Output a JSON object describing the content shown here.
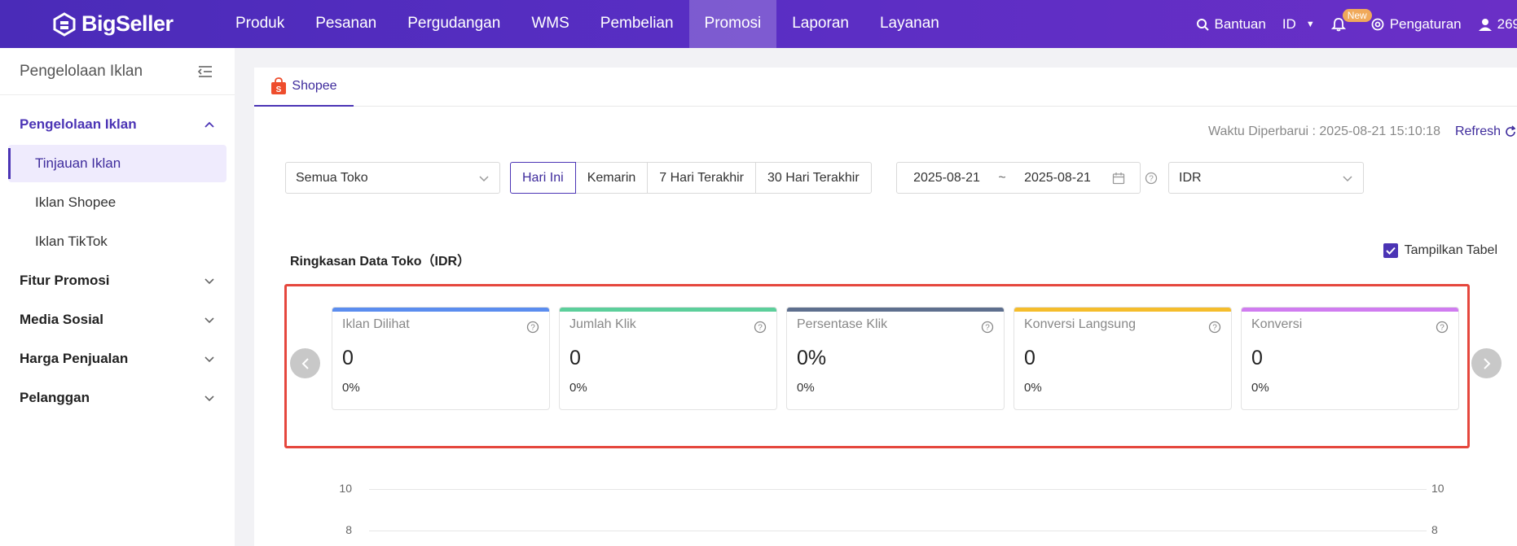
{
  "brand": {
    "name": "BigSeller"
  },
  "topnav": {
    "items": [
      "Produk",
      "Pesanan",
      "Pergudangan",
      "WMS",
      "Pembelian",
      "Promosi",
      "Laporan",
      "Layanan"
    ],
    "active": "Promosi",
    "help_label": "Bantuan",
    "language": "ID",
    "new_badge": "New",
    "settings_label": "Pengaturan",
    "user_label": "269"
  },
  "sidebar": {
    "title": "Pengelolaan Iklan",
    "groups": [
      {
        "label": "Pengelolaan Iklan",
        "open": true,
        "items": [
          {
            "label": "Tinjauan Iklan",
            "active": true
          },
          {
            "label": "Iklan Shopee"
          },
          {
            "label": "Iklan TikTok"
          }
        ]
      },
      {
        "label": "Fitur Promosi"
      },
      {
        "label": "Media Sosial"
      },
      {
        "label": "Harga Penjualan"
      },
      {
        "label": "Pelanggan"
      }
    ]
  },
  "main": {
    "tab": "Shopee",
    "update_text": "Waktu Diperbarui : 2025-08-21 15:10:18",
    "refresh_label": "Refresh",
    "shop_select": "Semua Toko",
    "range_buttons": [
      "Hari Ini",
      "Kemarin",
      "7 Hari Terakhir",
      "30 Hari Terakhir"
    ],
    "range_active": "Hari Ini",
    "date_from": "2025-08-21",
    "date_sep": "~",
    "date_to": "2025-08-21",
    "currency": "IDR",
    "section_title": "Ringkasan Data Toko（IDR）",
    "show_table_label": "Tampilkan Tabel",
    "show_table_checked": true,
    "cards": [
      {
        "label": "Iklan Dilihat",
        "value": "0",
        "pct": "0%",
        "color": "#5b8def"
      },
      {
        "label": "Jumlah Klik",
        "value": "0",
        "pct": "0%",
        "color": "#5ccf9b"
      },
      {
        "label": "Persentase Klik",
        "value": "0%",
        "pct": "0%",
        "color": "#5e6f8e"
      },
      {
        "label": "Konversi Langsung",
        "value": "0",
        "pct": "0%",
        "color": "#f5bd2c"
      },
      {
        "label": "Konversi",
        "value": "0",
        "pct": "0%",
        "color": "#d07cf0"
      }
    ],
    "axis_ticks": [
      "10",
      "8"
    ]
  },
  "colors": {
    "nav": "#5a2ec4",
    "accent": "#4b34b5",
    "highlight": "#e5473d",
    "shopee": "#ee4d2d"
  }
}
